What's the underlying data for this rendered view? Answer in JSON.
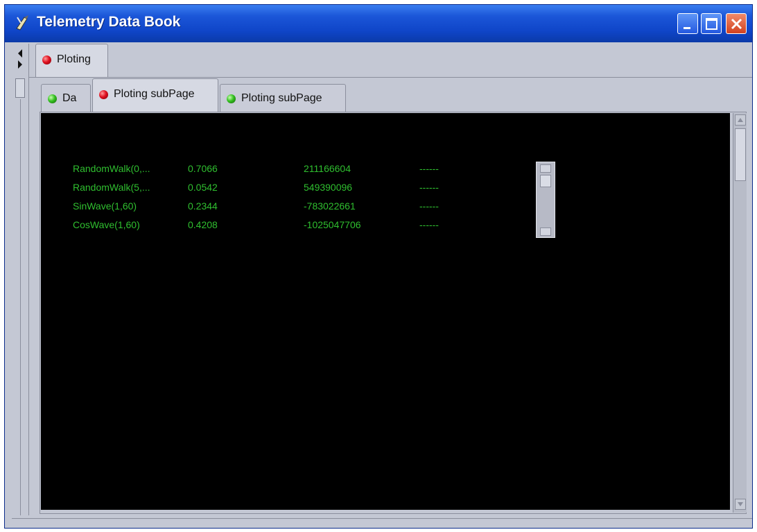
{
  "window": {
    "title": "Telemetry Data Book"
  },
  "outer_tabs": [
    {
      "label": "Ploting",
      "status": "red"
    }
  ],
  "inner_tabs": [
    {
      "label": "Da",
      "status": "green"
    },
    {
      "label": "Ploting subPage",
      "status": "red",
      "active": true
    },
    {
      "label": "Ploting subPage",
      "status": "green"
    }
  ],
  "rows": [
    {
      "name": "RandomWalk(0,...",
      "value": "0.7066",
      "raw": "211166604",
      "extra": "------"
    },
    {
      "name": "RandomWalk(5,...",
      "value": "0.0542",
      "raw": "549390096",
      "extra": "------"
    },
    {
      "name": "SinWave(1,60)",
      "value": "0.2344",
      "raw": "-783022661",
      "extra": "------"
    },
    {
      "name": "CosWave(1,60)",
      "value": "0.4208",
      "raw": "-1025047706",
      "extra": "------"
    }
  ],
  "colors": {
    "plot_background": "#000000",
    "data_text": "#2fbf2f",
    "title_bar": "#1b56d8",
    "status_red": "#e01020",
    "status_green": "#34c020"
  },
  "icons": {
    "app": "pen-icon",
    "minimize": "minimize-icon",
    "maximize": "maximize-icon",
    "close": "close-icon"
  }
}
